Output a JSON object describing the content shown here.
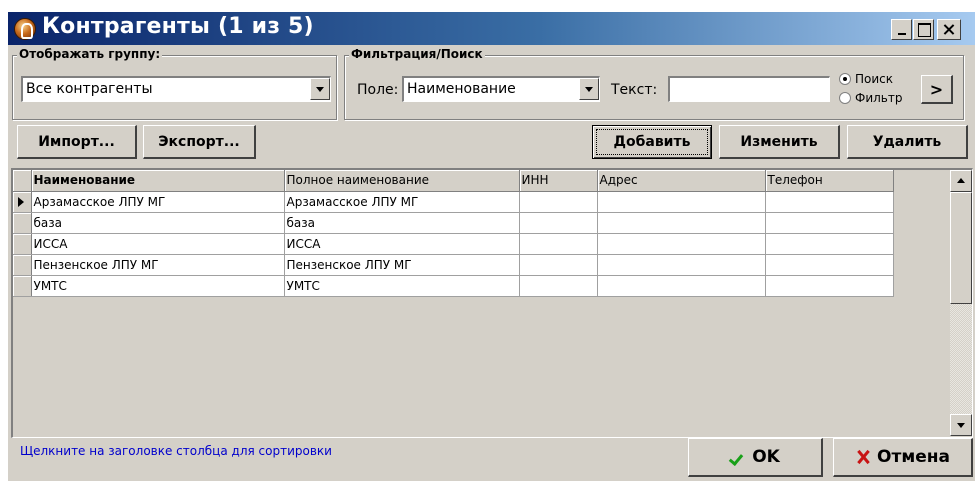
{
  "window": {
    "title": "Контрагенты (1 из 5)"
  },
  "group_filter": {
    "label": "Отображать группу:",
    "selected": "Все контрагенты"
  },
  "search": {
    "label": "Фильтрация/Поиск",
    "field_label": "Поле:",
    "field_selected": "Наименование",
    "text_label": "Текст:",
    "text_value": "",
    "mode_search": "Поиск",
    "mode_filter": "Фильтр",
    "mode_selected": "Поиск",
    "go_label": ">"
  },
  "toolbar": {
    "import_label": "Импорт...",
    "export_label": "Экспорт...",
    "add_label": "Добавить",
    "edit_label": "Изменить",
    "delete_label": "Удалить"
  },
  "grid": {
    "columns": [
      "Наименование",
      "Полное наименование",
      "ИНН",
      "Адрес",
      "Телефон"
    ],
    "rows": [
      [
        "Арзамасское  ЛПУ МГ",
        "Арзамасское  ЛПУ МГ",
        "",
        "",
        ""
      ],
      [
        "база",
        "база",
        "",
        "",
        ""
      ],
      [
        "ИССА",
        "ИССА",
        "",
        "",
        ""
      ],
      [
        "Пензенское ЛПУ МГ",
        "Пензенское ЛПУ МГ",
        "",
        "",
        ""
      ],
      [
        "УМТС",
        "УМТС",
        "",
        "",
        ""
      ]
    ],
    "current_row": 0
  },
  "footer": {
    "hint": "Щелкните на заголовке столбца для сортировки",
    "ok_label": "OK",
    "cancel_label": "Отмена"
  },
  "icons": {
    "app": "contractors-app-icon",
    "ok": "check-icon",
    "cancel": "x-icon"
  },
  "colors": {
    "titlebar_start": "#0a246a",
    "titlebar_end": "#a6caf0",
    "hint_text": "#0000cc",
    "ok_check": "#19a019",
    "cancel_x": "#c81414"
  }
}
